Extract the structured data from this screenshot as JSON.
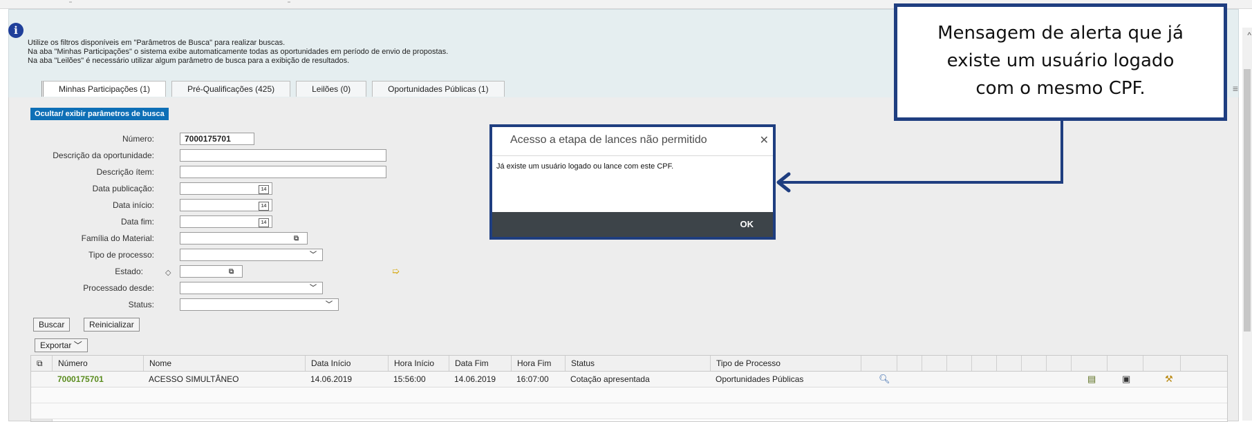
{
  "info": {
    "line1": "Utilize os filtros disponíveis em \"Parâmetros de Busca\" para realizar buscas.",
    "line2": "Na aba \"Minhas Participações\" o sistema exibe automaticamente todas as oportunidades em período de envio de propostas.",
    "line3": "Na aba \"Leilões\" é necessário utilizar algum parâmetro de busca para a exibição de resultados."
  },
  "tabs": [
    {
      "label": "Minhas Participações (1)"
    },
    {
      "label": "Pré-Qualificações (425)"
    },
    {
      "label": "Leilões (0)"
    },
    {
      "label": "Oportunidades Públicas (1)"
    }
  ],
  "toggle_button": "Ocultar/ exibir parâmetros de busca",
  "form": {
    "numero_label": "Número:",
    "numero_value": "7000175701",
    "descricao_oportunidade_label": "Descrição da oportunidade:",
    "descricao_item_label": "Descrição ítem:",
    "data_publicacao_label": "Data publicação:",
    "data_inicio_label": "Data início:",
    "data_fim_label": "Data fim:",
    "familia_material_label": "Família do Material:",
    "tipo_processo_label": "Tipo de processo:",
    "estado_label": "Estado:",
    "processado_desde_label": "Processado desde:",
    "status_label": "Status:",
    "calendar_glyph": "14"
  },
  "buttons": {
    "buscar": "Buscar",
    "reinicializar": "Reinicializar",
    "exportar": "Exportar"
  },
  "table": {
    "headers": [
      "Número",
      "Nome",
      "Data Início",
      "Hora Início",
      "Data Fim",
      "Hora Fim",
      "Status",
      "Tipo de Processo"
    ],
    "rows": [
      {
        "numero": "7000175701",
        "nome": "ACESSO SIMULTÂNEO",
        "data_inicio": "14.06.2019",
        "hora_inicio": "15:56:00",
        "data_fim": "14.06.2019",
        "hora_fim": "16:07:00",
        "status": "Cotação apresentada",
        "tipo_processo": "Oportunidades Públicas"
      }
    ]
  },
  "modal": {
    "title": "Acesso a etapa de lances não permitido",
    "close_glyph": "✕",
    "message": "Já existe um usuário logado ou lance com este CPF.",
    "ok_label": "OK"
  },
  "callout": {
    "line1": "Mensagem de alerta que já",
    "line2": "existe um usuário logado",
    "line3": "com o mesmo CPF."
  },
  "icons": {
    "info": "info-icon",
    "magnifier": "search-icon",
    "calendar": "calendar-icon",
    "value_help": "value-help-icon",
    "dropdown": "chevron-down-icon"
  },
  "colors": {
    "header_bg": "#e5eef0",
    "toggle_button_bg": "#0e6fb6",
    "link_green": "#5a8c1e",
    "callout_border": "#1f3e80",
    "modal_footer": "#3d4449"
  }
}
